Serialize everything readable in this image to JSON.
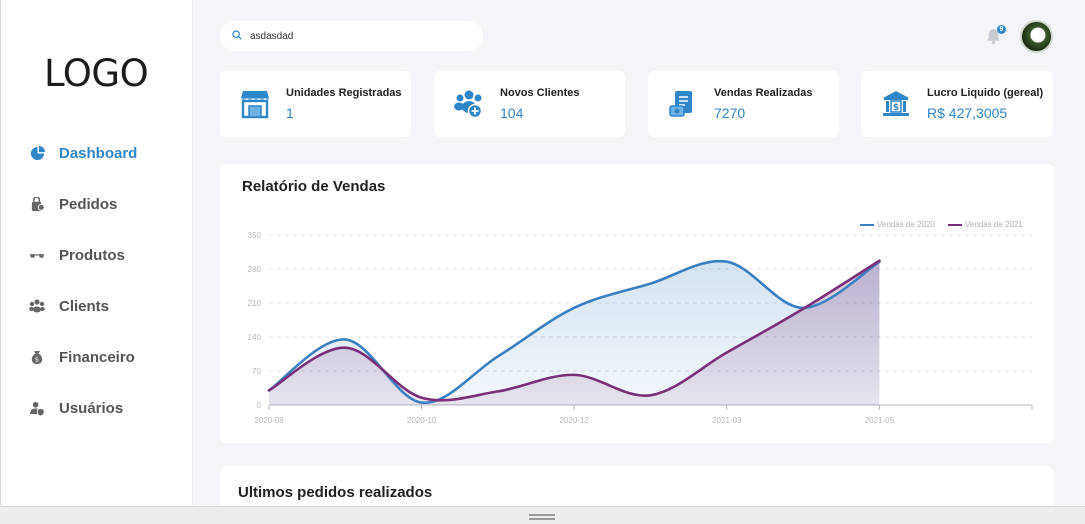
{
  "sidebar": {
    "logo": "LOGO",
    "items": [
      {
        "label": "Dashboard",
        "icon": "pie-chart-icon",
        "active": true
      },
      {
        "label": "Pedidos",
        "icon": "bag-icon",
        "active": false
      },
      {
        "label": "Produtos",
        "icon": "glasses-icon",
        "active": false
      },
      {
        "label": "Clients",
        "icon": "users-icon",
        "active": false
      },
      {
        "label": "Financeiro",
        "icon": "money-bag-icon",
        "active": false
      },
      {
        "label": "Usuários",
        "icon": "user-shield-icon",
        "active": false
      }
    ]
  },
  "header": {
    "search": {
      "value": "asdasdad",
      "icon": "search-icon"
    },
    "notifications": {
      "count": "9",
      "icon": "bell-icon"
    },
    "avatar": "avatar"
  },
  "cards": [
    {
      "title": "Unidades Registradas",
      "value": "1",
      "icon": "store-icon"
    },
    {
      "title": "Novos Clientes",
      "value": "104",
      "icon": "add-users-icon"
    },
    {
      "title": "Vendas Realizadas",
      "value": "7270",
      "icon": "receipt-icon"
    },
    {
      "title": "Lucro Liquido (gereal)",
      "value": "R$ 427,3005",
      "icon": "bank-icon"
    }
  ],
  "sales_report": {
    "title": "Relatório de Vendas"
  },
  "recent_orders": {
    "title": "Ultimos pedidos realizados"
  },
  "colors": {
    "accent": "#2f86c8",
    "series_2020": "#3a7fbf",
    "series_2021": "#7a2f78"
  },
  "chart_data": {
    "type": "area",
    "title": "",
    "xlabel": "",
    "ylabel": "",
    "legend_position": "top-right",
    "grid": true,
    "ylim": [
      0,
      350
    ],
    "yticks": [
      "0",
      "70",
      "140",
      "210",
      "280",
      "350"
    ],
    "xticks": [
      "2020-08",
      "2020-10",
      "2020-12",
      "2021-03",
      "2021-05"
    ],
    "series": [
      {
        "name": "Vendas de 2020",
        "points": [
          [
            0,
            30
          ],
          [
            1,
            135
          ],
          [
            2,
            5
          ],
          [
            3,
            100
          ],
          [
            4,
            200
          ],
          [
            5,
            250
          ],
          [
            6,
            295
          ],
          [
            7,
            200
          ],
          [
            8,
            295
          ]
        ]
      },
      {
        "name": "Vendas de 2021",
        "points": [
          [
            0,
            30
          ],
          [
            1,
            118
          ],
          [
            2,
            15
          ],
          [
            3,
            28
          ],
          [
            4,
            62
          ],
          [
            5,
            20
          ],
          [
            6,
            108
          ],
          [
            7,
            198
          ],
          [
            8,
            297
          ]
        ]
      }
    ]
  }
}
